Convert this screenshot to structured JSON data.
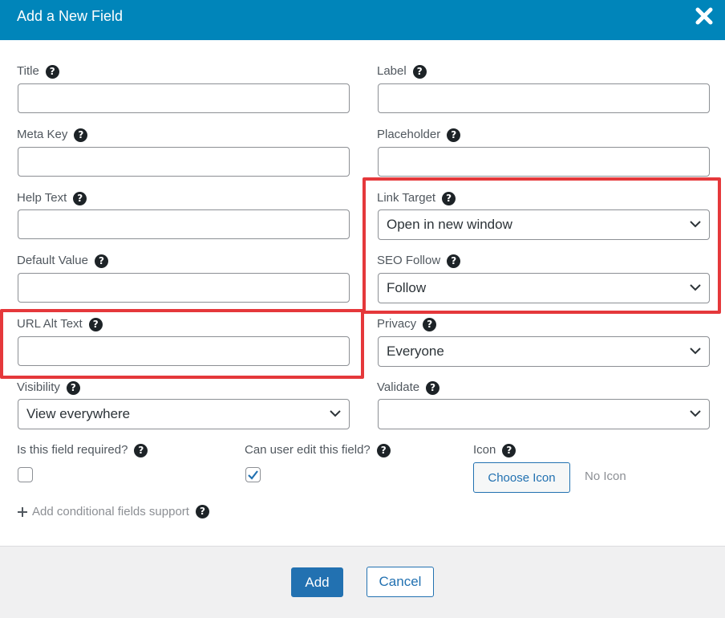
{
  "dialog": {
    "title": "Add a New Field",
    "close_icon": "close-x-icon"
  },
  "fields": {
    "title": {
      "label": "Title",
      "value": ""
    },
    "label": {
      "label": "Label",
      "value": ""
    },
    "meta_key": {
      "label": "Meta Key",
      "value": ""
    },
    "placeholder": {
      "label": "Placeholder",
      "value": ""
    },
    "help_text": {
      "label": "Help Text",
      "value": ""
    },
    "link_target": {
      "label": "Link Target",
      "selected": "Open in new window"
    },
    "default_value": {
      "label": "Default Value",
      "value": ""
    },
    "seo_follow": {
      "label": "SEO Follow",
      "selected": "Follow"
    },
    "url_alt_text": {
      "label": "URL Alt Text",
      "value": ""
    },
    "privacy": {
      "label": "Privacy",
      "selected": "Everyone"
    },
    "visibility": {
      "label": "Visibility",
      "selected": "View everywhere"
    },
    "validate": {
      "label": "Validate",
      "selected": ""
    }
  },
  "options": {
    "required": {
      "label": "Is this field required?",
      "checked": false
    },
    "editable": {
      "label": "Can user edit this field?",
      "checked": true
    },
    "icon": {
      "label": "Icon",
      "button": "Choose Icon",
      "status": "No Icon"
    }
  },
  "conditional": {
    "label": "Add conditional fields support"
  },
  "footer": {
    "add": "Add",
    "cancel": "Cancel"
  },
  "help_glyph": "?",
  "colors": {
    "header": "#0085ba",
    "highlight": "#e5383b",
    "primary": "#2271b1"
  }
}
